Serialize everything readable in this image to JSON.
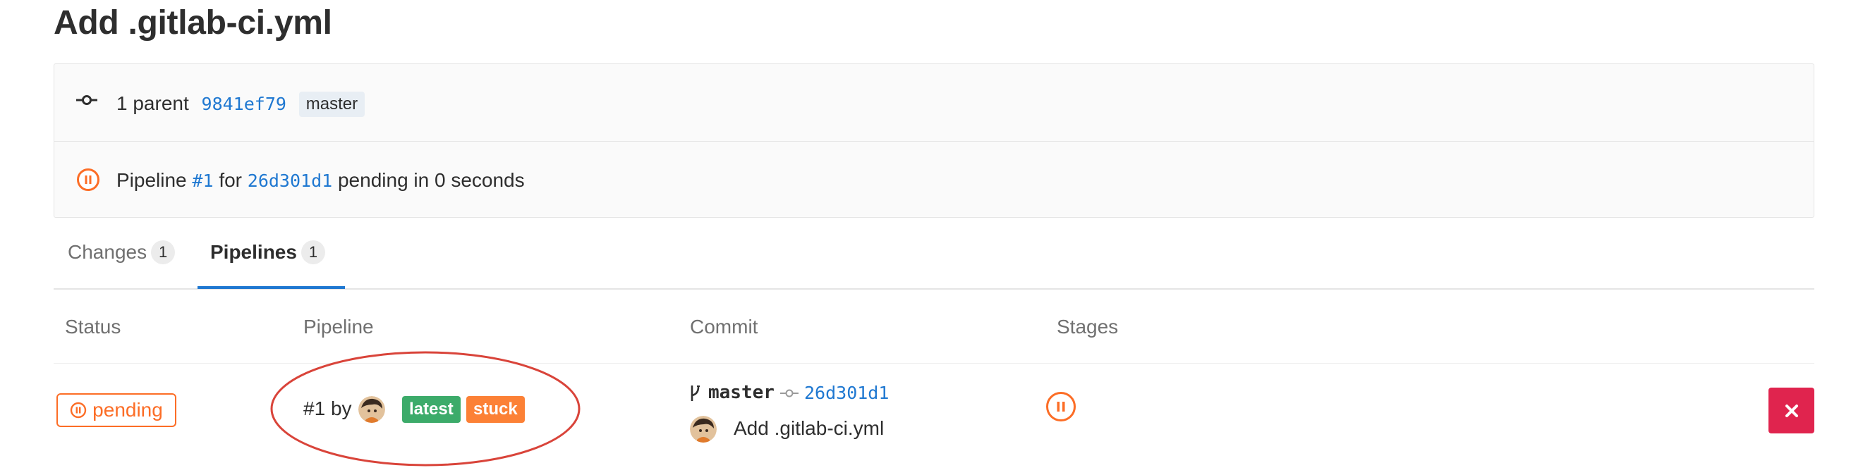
{
  "page_title": "Add .gitlab-ci.yml",
  "commit_info": {
    "parent_label": "1 parent",
    "parent_sha": "9841ef79",
    "branch": "master"
  },
  "pipeline_info": {
    "prefix": "Pipeline",
    "pipeline_id": "#1",
    "for": "for",
    "commit_sha": "26d301d1",
    "status_text": "pending in 0 seconds"
  },
  "tabs": [
    {
      "label": "Changes",
      "count": "1",
      "active": false
    },
    {
      "label": "Pipelines",
      "count": "1",
      "active": true
    }
  ],
  "table": {
    "headers": [
      "Status",
      "Pipeline",
      "Commit",
      "Stages"
    ],
    "rows": [
      {
        "status": "pending",
        "pipeline_id": "#1",
        "by": "by",
        "badges": [
          "latest",
          "stuck"
        ],
        "branch": "master",
        "commit_sha": "26d301d1",
        "commit_title": "Add .gitlab-ci.yml"
      }
    ]
  },
  "icons": {
    "commit": "commit-icon",
    "pending_status": "pause-circle-icon",
    "branch": "branch-icon",
    "delete": "close-icon"
  },
  "colors": {
    "link": "#1f78d1",
    "pending": "#fc6d26",
    "badge_latest": "#3cab6a",
    "badge_stuck": "#fc8136",
    "delete_button": "#e0244e",
    "annotation_circle": "#d9443a"
  }
}
